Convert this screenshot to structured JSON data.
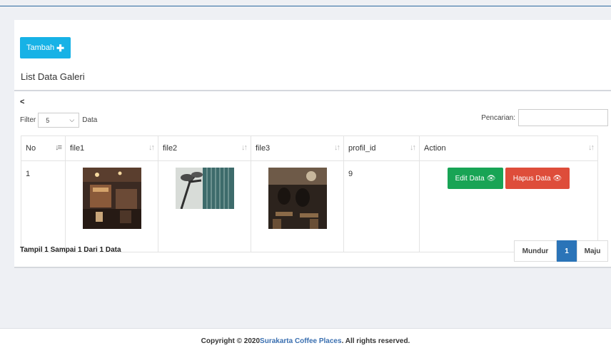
{
  "header": {
    "add_button_label": "Tambah",
    "add_button_icon": "plus-icon",
    "title": "List Data Galeri"
  },
  "table_controls": {
    "back_label": "<",
    "filter_label": "Filter",
    "filter_value": "5",
    "filter_suffix": "Data",
    "search_label": "Pencarian:",
    "search_value": ""
  },
  "table": {
    "columns": [
      "No",
      "file1",
      "file2",
      "file3",
      "profil_id",
      "Action"
    ],
    "rows": [
      {
        "no": "1",
        "profil_id": "9"
      }
    ],
    "edit_label": "Edit Data",
    "delete_label": "Hapus Data",
    "action_icon": "eye-icon"
  },
  "pagination": {
    "info": "Tampil 1 Sampai 1 Dari 1 Data",
    "prev_label": "Mundur",
    "current_page": "1",
    "next_label": "Maju"
  },
  "footer": {
    "prefix": "Copyright © 2020 ",
    "brand": "Surakarta Coffee Places",
    "suffix": ". All rights reserved."
  },
  "colors": {
    "add_button": "#17b2e6",
    "edit_button": "#18a455",
    "delete_button": "#de4d3a",
    "active_page": "#2b74b8",
    "brand_link": "#3a6fb0"
  }
}
